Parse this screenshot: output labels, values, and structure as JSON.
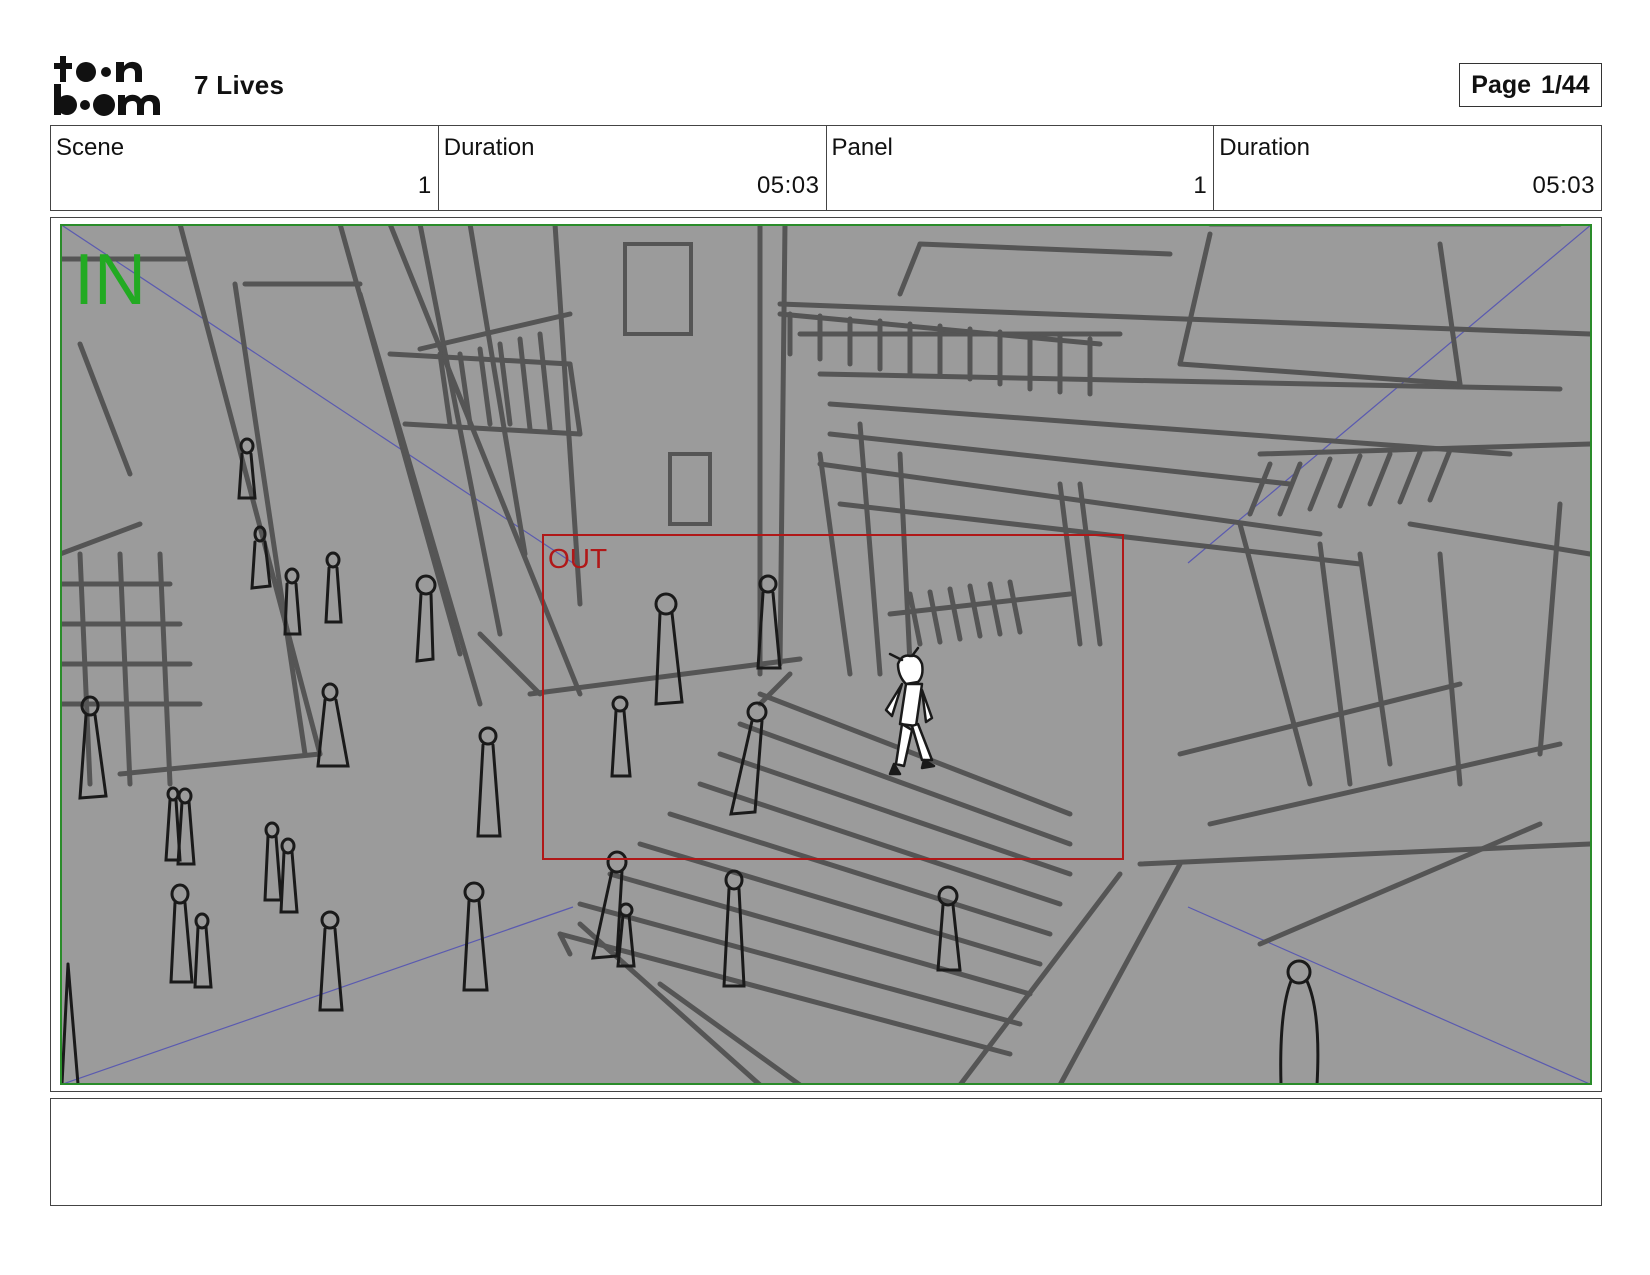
{
  "header": {
    "logo_text": "toon boom",
    "project_title": "7 Lives",
    "page_label": "Page",
    "page_value": "1/44"
  },
  "info_bar": [
    {
      "label": "Scene",
      "value": "1"
    },
    {
      "label": "Duration",
      "value": "05:03"
    },
    {
      "label": "Panel",
      "value": "1"
    },
    {
      "label": "Duration",
      "value": "05:03"
    }
  ],
  "panel": {
    "in_label": "IN",
    "out_label": "OUT",
    "colors": {
      "background": "#9b9b9b",
      "sketch_lines": "#555555",
      "figure_lines": "#1a1a1a",
      "in_frame": "#2a8c2a",
      "in_text": "#22aa22",
      "out_frame": "#b01818",
      "guide_lines": "#5a5ab0"
    }
  },
  "notes": {
    "text": ""
  }
}
